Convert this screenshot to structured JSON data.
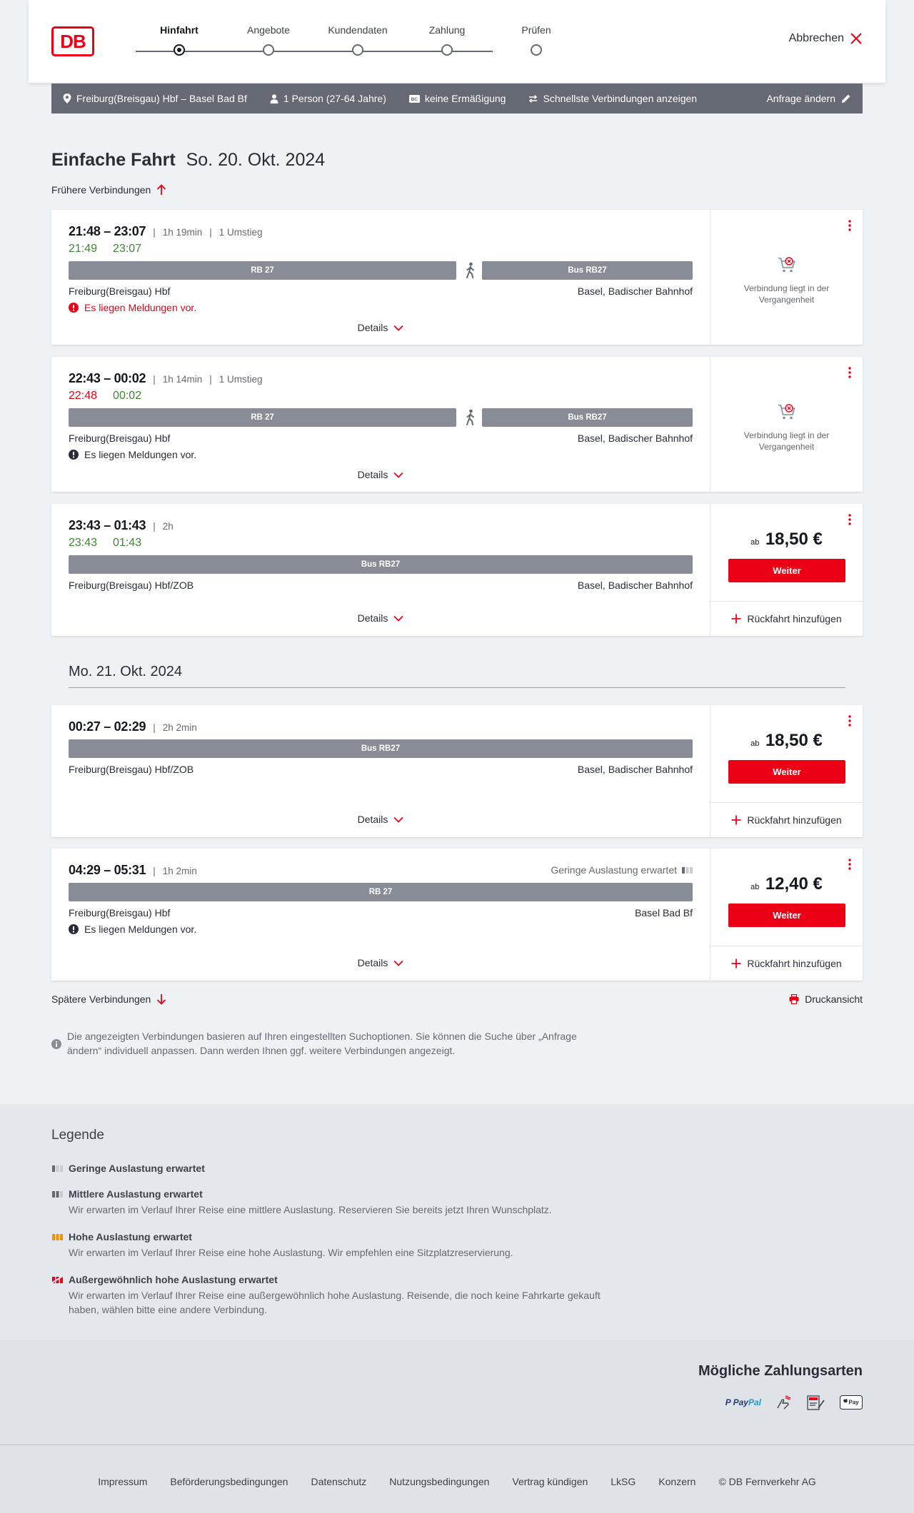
{
  "header": {
    "logo_text": "DB",
    "steps": [
      "Hinfahrt",
      "Angebote",
      "Kundendaten",
      "Zahlung",
      "Prüfen"
    ],
    "active_step": 0,
    "cancel_label": "Abbrechen"
  },
  "summary": {
    "route": "Freiburg(Breisgau) Hbf – Basel Bad Bf",
    "passengers": "1 Person (27-64 Jahre)",
    "discount": "keine Ermäßigung",
    "fastest": "Schnellste Verbindungen anzeigen",
    "edit_label": "Anfrage ändern"
  },
  "page": {
    "title": "Einfache Fahrt",
    "date": "So. 20. Okt. 2024",
    "earlier": "Frühere Verbindungen",
    "later": "Spätere Verbindungen",
    "print": "Druckansicht",
    "next_date": "Mo. 21. Okt. 2024",
    "info": "Die angezeigten Verbindungen basieren auf Ihren eingestellten Suchoptionen. Sie können die Suche über „Anfrage ändern“ individuell anpassen. Dann werden Ihnen ggf. weitere Verbindungen angezeigt."
  },
  "connections": [
    {
      "times": "21:48 – 23:07",
      "duration": "1h 19min",
      "transfers": "1 Umstieg",
      "rt_dep": "21:49",
      "rt_arr": "23:07",
      "segments": [
        "RB 27",
        "Bus RB27"
      ],
      "from": "Freiburg(Breisgau) Hbf",
      "to": "Basel, Badischer Bahnhof",
      "notice": "Es liegen Meldungen vor.",
      "details": "Details",
      "past_text": "Verbindung liegt in der Vergangenheit"
    },
    {
      "times": "22:43 – 00:02",
      "duration": "1h 14min",
      "transfers": "1 Umstieg",
      "rt_dep": "22:48",
      "rt_arr": "00:02",
      "segments": [
        "RB 27",
        "Bus RB27"
      ],
      "from": "Freiburg(Breisgau) Hbf",
      "to": "Basel, Badischer Bahnhof",
      "notice": "Es liegen Meldungen vor.",
      "details": "Details",
      "past_text": "Verbindung liegt in der Vergangenheit"
    },
    {
      "times": "23:43 – 01:43",
      "duration": "2h",
      "rt_dep": "23:43",
      "rt_arr": "01:43",
      "segments": [
        "Bus RB27"
      ],
      "from": "Freiburg(Breisgau) Hbf/ZOB",
      "to": "Basel, Badischer Bahnhof",
      "details": "Details",
      "price_prefix": "ab",
      "price": "18,50 €",
      "button": "Weiter",
      "return": "Rückfahrt hinzufügen"
    },
    {
      "times": "00:27 – 02:29",
      "duration": "2h 2min",
      "segments": [
        "Bus RB27"
      ],
      "from": "Freiburg(Breisgau) Hbf/ZOB",
      "to": "Basel, Badischer Bahnhof",
      "details": "Details",
      "price_prefix": "ab",
      "price": "18,50 €",
      "button": "Weiter",
      "return": "Rückfahrt hinzufügen"
    },
    {
      "times": "04:29 – 05:31",
      "duration": "1h 2min",
      "occupancy": "Geringe Auslastung erwartet",
      "segments": [
        "RB 27"
      ],
      "from": "Freiburg(Breisgau) Hbf",
      "to": "Basel Bad Bf",
      "notice": "Es liegen Meldungen vor.",
      "details": "Details",
      "price_prefix": "ab",
      "price": "12,40 €",
      "button": "Weiter",
      "return": "Rückfahrt hinzufügen"
    }
  ],
  "legend": {
    "title": "Legende",
    "items": [
      {
        "heading": "Geringe Auslastung erwartet",
        "text": ""
      },
      {
        "heading": "Mittlere Auslastung erwartet",
        "text": "Wir erwarten im Verlauf Ihrer Reise eine mittlere Auslastung. Reservieren Sie bereits jetzt Ihren Wunschplatz."
      },
      {
        "heading": "Hohe Auslastung erwartet",
        "text": "Wir erwarten im Verlauf Ihrer Reise eine hohe Auslastung. Wir empfehlen eine Sitzplatzreservierung."
      },
      {
        "heading": "Außergewöhnlich hohe Auslastung erwartet",
        "text": "Wir erwarten im Verlauf Ihrer Reise eine außergewöhnlich hohe Auslastung. Reisende, die noch keine Fahrkarte gekauft haben, wählen bitte eine andere Verbindung."
      }
    ]
  },
  "payment": {
    "title": "Mögliche Zahlungsarten",
    "methods": [
      "PayPal",
      "Kreditkarte",
      "SEPA",
      "Apple Pay"
    ],
    "paypal_a": "Pay",
    "paypal_b": "Pal",
    "applepay": "Pay"
  },
  "footer": {
    "links": [
      "Impressum",
      "Beförderungsbedingungen",
      "Datenschutz",
      "Nutzungsbedingungen",
      "Vertrag kündigen",
      "LkSG",
      "Konzern",
      "© DB Fernverkehr AG"
    ]
  },
  "colors": {
    "brand_red": "#ec0016",
    "on_time_green": "#408335",
    "segment_gray": "#878c96",
    "summary_bar": "#646973"
  }
}
